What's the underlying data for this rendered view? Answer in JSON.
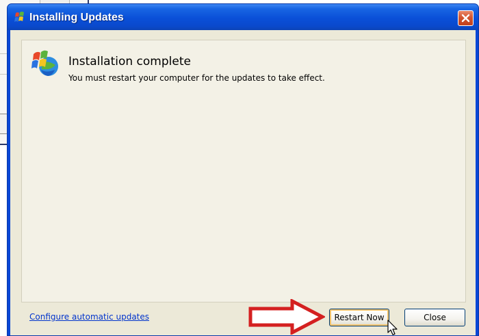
{
  "dialog": {
    "title": "Installing Updates",
    "title_icon": "windows-update-icon",
    "close_icon": "close-x-icon"
  },
  "content": {
    "icon": "windows-update-logo-icon",
    "heading": "Installation complete",
    "message": "You must restart your computer for the updates to take effect."
  },
  "footer": {
    "configure_link": "Configure automatic updates",
    "restart_button": "Restart Now",
    "close_button": "Close"
  },
  "overlay": {
    "arrow_icon": "red-arrow-icon",
    "cursor_icon": "mouse-pointer-icon",
    "arrow_color": "#d42020"
  },
  "colors": {
    "titlebar": "#0a4fd8",
    "client_bg": "#ece9d8",
    "link": "#0033cc",
    "close_button": "#d3552f"
  }
}
